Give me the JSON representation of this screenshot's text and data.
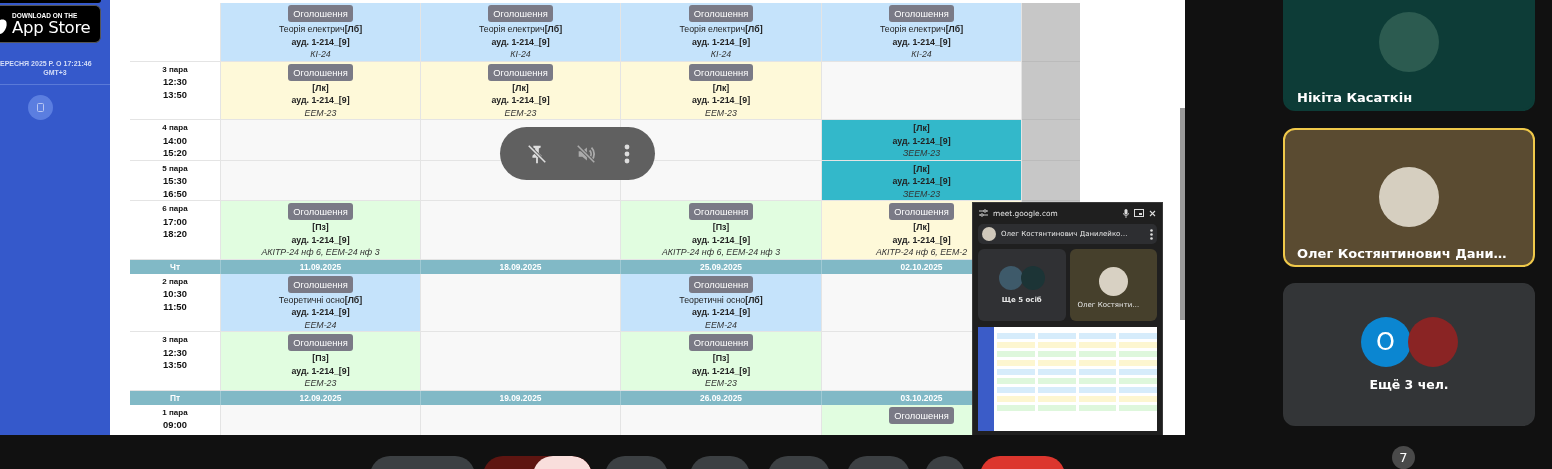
{
  "sidebar": {
    "badge": {
      "caption": "DOWNLOAD ON THE",
      "title": "App Store"
    },
    "timestamp": "ЕРЕСНЯ 2025 Р. О 17:21:46",
    "timezone": "GMT+3"
  },
  "schedule": {
    "sections": [
      {
        "rows": [
          {
            "time": [],
            "cells": [
              {
                "kind": "lesson",
                "color": "#c5e3fb",
                "button": "Оголошення",
                "subject": "Теорія електрич",
                "type": "[Лб]",
                "room": "ауд. 1-214_[9]",
                "groups": "КІ-24"
              },
              {
                "kind": "lesson",
                "color": "#c5e3fb",
                "button": "Оголошення",
                "subject": "Теорія електрич",
                "type": "[Лб]",
                "room": "ауд. 1-214_[9]",
                "groups": "КІ-24"
              },
              {
                "kind": "lesson",
                "color": "#c5e3fb",
                "button": "Оголошення",
                "subject": "Теорія електрич",
                "type": "[Лб]",
                "room": "ауд. 1-214_[9]",
                "groups": "КІ-24"
              },
              {
                "kind": "lesson",
                "color": "#c5e3fb",
                "button": "Оголошення",
                "subject": "Теорія електрич",
                "type": "[Лб]",
                "room": "ауд. 1-214_[9]",
                "groups": "КІ-24"
              },
              {
                "kind": "unavailable"
              }
            ]
          },
          {
            "time": [
              "3 пара",
              "12:30",
              "13:50"
            ],
            "cells": [
              {
                "kind": "lesson",
                "color": "#fef9d9",
                "button": "Оголошення",
                "type": "[Лк]",
                "room": "ауд. 1-214_[9]",
                "groups": "ЕЕМ-23"
              },
              {
                "kind": "lesson",
                "color": "#fef9d9",
                "button": "Оголошення",
                "type": "[Лк]",
                "room": "ауд. 1-214_[9]",
                "groups": "ЕЕМ-23"
              },
              {
                "kind": "lesson",
                "color": "#fef9d9",
                "button": "Оголошення",
                "type": "[Лк]",
                "room": "ауд. 1-214_[9]",
                "groups": "ЕЕМ-23"
              },
              {
                "kind": "empty"
              },
              {
                "kind": "unavailable"
              }
            ]
          },
          {
            "time": [
              "4 пара",
              "14:00",
              "15:20"
            ],
            "cells": [
              {
                "kind": "empty"
              },
              {
                "kind": "empty"
              },
              {
                "kind": "empty"
              },
              {
                "kind": "lesson",
                "color": "#33b8ca",
                "type": "[Лк]",
                "room": "ауд. 1-214_[9]",
                "groups": "ЗЕЕМ-23"
              },
              {
                "kind": "unavailable"
              }
            ]
          },
          {
            "time": [
              "5 пара",
              "15:30",
              "16:50"
            ],
            "cells": [
              {
                "kind": "empty"
              },
              {
                "kind": "empty"
              },
              {
                "kind": "empty"
              },
              {
                "kind": "lesson",
                "color": "#33b8ca",
                "type": "[Лк]",
                "room": "ауд. 1-214_[9]",
                "groups": "ЗЕЕМ-23"
              },
              {
                "kind": "unavailable"
              }
            ]
          },
          {
            "time": [
              "6 пара",
              "17:00",
              "18:20"
            ],
            "cells": [
              {
                "kind": "lesson",
                "color": "#e1fde0",
                "button": "Оголошення",
                "type": "[Пз]",
                "room": "ауд. 1-214_[9]",
                "groups": "АКІТР-24 нф 6, ЕЕМ-24 нф 3"
              },
              {
                "kind": "empty"
              },
              {
                "kind": "lesson",
                "color": "#e1fde0",
                "button": "Оголошення",
                "type": "[Пз]",
                "room": "ауд. 1-214_[9]",
                "groups": "АКІТР-24 нф 6, ЕЕМ-24 нф 3"
              },
              {
                "kind": "lesson",
                "color": "#fef9d9",
                "button": "Оголошення",
                "type": "[Лк]",
                "room": "ауд. 1-214_[9]",
                "groups": "АКІТР-24 нф 6, ЕЕМ-2"
              },
              {
                "kind": "unavailable"
              }
            ]
          }
        ]
      },
      {
        "header": {
          "day": "Чт",
          "dates": [
            "11.09.2025",
            "18.09.2025",
            "25.09.2025",
            "02.10.2025"
          ]
        },
        "rows": [
          {
            "time": [
              "2 пара",
              "10:30",
              "11:50"
            ],
            "cells": [
              {
                "kind": "lesson",
                "color": "#c5e3fb",
                "button": "Оголошення",
                "subject": "Теоретичні осно",
                "type": "[Лб]",
                "room": "ауд. 1-214_[9]",
                "groups": "ЕЕМ-24"
              },
              {
                "kind": "empty"
              },
              {
                "kind": "lesson",
                "color": "#c5e3fb",
                "button": "Оголошення",
                "subject": "Теоретичні осно",
                "type": "[Лб]",
                "room": "ауд. 1-214_[9]",
                "groups": "ЕЕМ-24"
              },
              {
                "kind": "empty"
              }
            ]
          },
          {
            "time": [
              "3 пара",
              "12:30",
              "13:50"
            ],
            "cells": [
              {
                "kind": "lesson",
                "color": "#e1fde0",
                "button": "Оголошення",
                "type": "[Пз]",
                "room": "ауд. 1-214_[9]",
                "groups": "ЕЕМ-23"
              },
              {
                "kind": "empty"
              },
              {
                "kind": "lesson",
                "color": "#e1fde0",
                "button": "Оголошення",
                "type": "[Пз]",
                "room": "ауд. 1-214_[9]",
                "groups": "ЕЕМ-23"
              },
              {
                "kind": "empty"
              }
            ]
          }
        ]
      },
      {
        "header": {
          "day": "Пт",
          "dates": [
            "12.09.2025",
            "19.09.2025",
            "26.09.2025",
            "03.10.2025"
          ]
        },
        "rows": [
          {
            "time": [
              "1 пара",
              "09:00"
            ],
            "cells": [
              {
                "kind": "empty"
              },
              {
                "kind": "empty"
              },
              {
                "kind": "empty"
              },
              {
                "kind": "lesson",
                "color": "#e1fde0",
                "button": "Оголошення"
              }
            ]
          }
        ]
      }
    ]
  },
  "pip": {
    "url": "meet.google.com",
    "presenter": "Олег Костянтинович Данилейко…",
    "tiles": [
      {
        "kind": "group",
        "label": "Ще 5 осіб"
      },
      {
        "kind": "person",
        "label": "Олег Костянти…"
      }
    ]
  },
  "participants": [
    {
      "kind": "person",
      "name": "Нікіта Касаткін",
      "color": "#0d3c37",
      "speaking": false
    },
    {
      "kind": "person",
      "name": "Олег Костянтинович Дани…",
      "color": "#5a4b31",
      "speaking": true
    },
    {
      "kind": "group",
      "name": "Ещё 3 чел.",
      "initial": "О",
      "color": "#333537",
      "speaking": false
    }
  ],
  "participant_count": "7"
}
